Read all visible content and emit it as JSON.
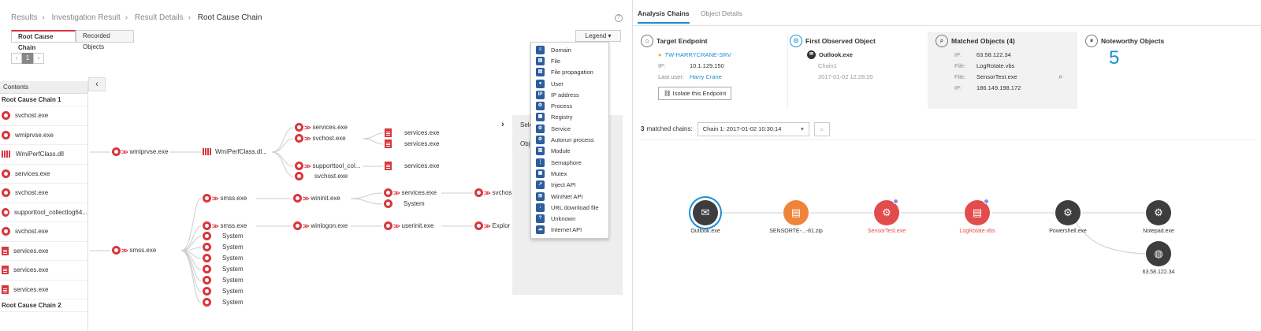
{
  "breadcrumb": {
    "items": [
      "Results",
      "Investigation Result",
      "Result Details"
    ],
    "current": "Root Cause Chain"
  },
  "left_tabs": [
    "Root Cause Chain",
    "Recorded Objects"
  ],
  "pager": {
    "prev": "‹",
    "page": "1",
    "next": "›"
  },
  "legend_button": "Legend ▾",
  "contents": {
    "header": "Contents",
    "collapse_glyph": "‹",
    "chain1": "Root Cause Chain 1",
    "chain2": "Root Cause Chain 2",
    "items": [
      {
        "icon": "gear",
        "label": "svchost.exe"
      },
      {
        "icon": "gear",
        "label": "wmiprvse.exe"
      },
      {
        "icon": "dll",
        "label": "WmiPerfClass.dll"
      },
      {
        "icon": "gear",
        "label": "services.exe"
      },
      {
        "icon": "gear",
        "label": "svchost.exe"
      },
      {
        "icon": "gear",
        "label": "supporttool_collectlog64..."
      },
      {
        "icon": "gear",
        "label": "svchost.exe"
      },
      {
        "icon": "doc",
        "label": "services.exe"
      },
      {
        "icon": "doc",
        "label": "services.exe"
      },
      {
        "icon": "doc",
        "label": "services.exe"
      }
    ]
  },
  "graph": {
    "wmiprvse": "wmiprvse.exe",
    "wmiperf": "WmiPerfClass.dl...",
    "services1": "services.exe",
    "svchost1": "svchost.exe",
    "doc_services1": "services.exe",
    "doc_services2": "services.exe",
    "supporttool": "supporttool_col...",
    "svchost2": "svchost.exe",
    "doc_services3": "services.exe",
    "smss_main": "smss.exe",
    "smss1": "smss.exe",
    "wininit": "wininit.exe",
    "services2": "services.exe",
    "system1": "System",
    "svchost_trunc": "svchos",
    "smss2": "smss.exe",
    "winlogon": "winlogon.exe",
    "userinit": "userinit.exe",
    "explorer_trunc": "Explor",
    "systems": [
      "System",
      "System",
      "System",
      "System",
      "System",
      "System",
      "System"
    ]
  },
  "gray_panel": {
    "chevron": "›",
    "sele": "Sele",
    "obj": "Obj"
  },
  "legend": [
    {
      "icon": "server-icon",
      "label": "Domain"
    },
    {
      "icon": "file-icon",
      "label": "File"
    },
    {
      "icon": "file-propagation-icon",
      "label": "File propagation"
    },
    {
      "icon": "user-icon",
      "label": "User"
    },
    {
      "icon": "ip-icon",
      "label": "IP address"
    },
    {
      "icon": "gear-icon",
      "label": "Process"
    },
    {
      "icon": "registry-icon",
      "label": "Registry"
    },
    {
      "icon": "gear-icon",
      "label": "Service"
    },
    {
      "icon": "gear-icon",
      "label": "Autorun process"
    },
    {
      "icon": "module-icon",
      "label": "Module"
    },
    {
      "icon": "semaphore-icon",
      "label": "Semaphore"
    },
    {
      "icon": "lock-icon",
      "label": "Mutex"
    },
    {
      "icon": "syringe-icon",
      "label": "Inject API"
    },
    {
      "icon": "wininet-icon",
      "label": "WinINet API"
    },
    {
      "icon": "download-icon",
      "label": "URL download file"
    },
    {
      "icon": "question-icon",
      "label": "Unknown"
    },
    {
      "icon": "cloud-api-icon",
      "label": "Internet API"
    }
  ],
  "right_tabs": [
    "Analysis Chains",
    "Object Details"
  ],
  "target_endpoint": {
    "title": "Target Endpoint",
    "host": "TW-HARRYCRANE-SRV",
    "ip_key": "IP:",
    "ip": "10.1.129.150",
    "user_key": "Last user:",
    "user": "Harry Crane",
    "isolate": "Isolate this Endpoint"
  },
  "first_observed": {
    "title": "First Observed Object",
    "name": "Outlook.exe",
    "chain": "Chain1",
    "date": "2017-01-02 12:28:20"
  },
  "matched": {
    "title": "Matched Objects (4)",
    "rows": [
      {
        "k": "IP:",
        "v": "63.58.122.34"
      },
      {
        "k": "File:",
        "v": "LogRotate.vbs"
      },
      {
        "k": "File:",
        "v": "SensorTest.exe"
      },
      {
        "k": "IP:",
        "v": "186.149.198.172"
      }
    ]
  },
  "noteworthy": {
    "title": "Noteworthy Objects",
    "count": "5"
  },
  "chains": {
    "count": "3",
    "label": "matched chains:",
    "selected": "Chain 1: 2017-01-02 10:30:14"
  },
  "analysis_graph": [
    {
      "label": "Outlook.exe",
      "style": "dark",
      "glyph": "✉",
      "red_label": false
    },
    {
      "label": "SENSORTE-...-81.zip",
      "style": "orange",
      "glyph": "▤",
      "red_label": false
    },
    {
      "label": "SensorTest.exe",
      "style": "red",
      "glyph": "⚙",
      "red_label": true
    },
    {
      "label": "LogRotate.vbs",
      "style": "red",
      "glyph": "▤",
      "red_label": true
    },
    {
      "label": "Powershell.exe",
      "style": "dark",
      "glyph": "⚙",
      "red_label": false
    },
    {
      "label": "Notepad.exe",
      "style": "dark",
      "glyph": "⚙",
      "red_label": false
    },
    {
      "label": "63.58.122.34",
      "style": "dark",
      "glyph": "◍",
      "red_label": false
    }
  ]
}
